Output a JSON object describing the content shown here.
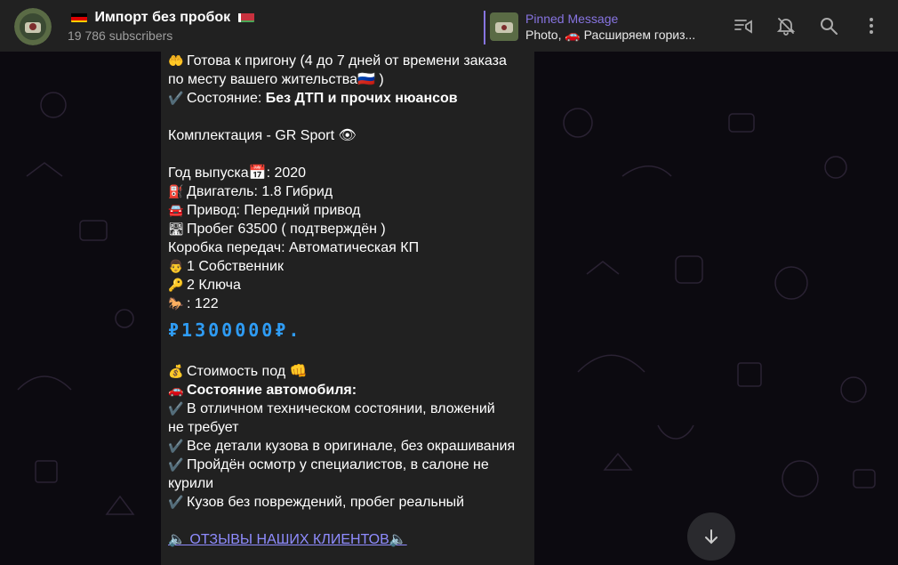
{
  "header": {
    "title": "Импорт без пробок",
    "subscribers": "19 786 subscribers"
  },
  "pinned": {
    "label": "Pinned Message",
    "preview": "Photo, 🚗  Расширяем гориз..."
  },
  "icons": [
    "live-stream-icon",
    "mute-bell-icon",
    "search-icon",
    "more-vert-icon",
    "scroll-down-icon"
  ],
  "message": {
    "lines": [
      {
        "icon": "🤲",
        "text": "Готова к пригону (4 до 7 дней от времени заказа"
      },
      {
        "icon": "",
        "text": "по месту вашего жительства🇷🇺 )"
      },
      {
        "icon": "✔️",
        "text": "Состояние: ",
        "bold": "Без ДТП и прочих нюансов"
      },
      {
        "icon": "",
        "text": "Комплектация - GR Sport 👁"
      },
      {
        "icon": "",
        "text": "Год выпуска📅: 2020"
      },
      {
        "icon": "⛽",
        "text": "Двигатель: 1.8 Гибрид"
      },
      {
        "icon": "🚘",
        "text": "Привод: Передний привод"
      },
      {
        "icon": "🛣",
        "text": "Пробег  63500 ( подтверждён )"
      },
      {
        "icon": "",
        "text": " Коробка передач: Автоматическая   КП"
      },
      {
        "icon": "👨",
        "text": "1 Собственник"
      },
      {
        "icon": "🔑",
        "text": "2 Ключа"
      },
      {
        "icon": "🐎",
        "text": ":  122"
      },
      {
        "price": "₽1300000₽."
      },
      {
        "icon": "💰",
        "text": "Стоимость под 👊"
      },
      {
        "icon": "🚗",
        "bold": "Состояние автомобиля:"
      },
      {
        "icon": "✔️",
        "text": "В отличном техническом состоянии, вложений"
      },
      {
        "icon": "",
        "text": "не требует"
      },
      {
        "icon": "✔️",
        "text": "Все детали кузова в оригинале, без окрашивания"
      },
      {
        "icon": "✔️",
        "text": "Пройдён осмотр у специалистов, в салоне не"
      },
      {
        "icon": "",
        "text": "курили"
      },
      {
        "icon": "✔️",
        "text": "Кузов без повреждений, пробег реальный"
      },
      {
        "link": "🔈 ОТЗЫВЫ НАШИХ КЛИЕНТОВ🔈"
      }
    ]
  },
  "colors": {
    "accent": "#8774e1",
    "price": "#2f9cf4",
    "link": "#8f8cff"
  }
}
